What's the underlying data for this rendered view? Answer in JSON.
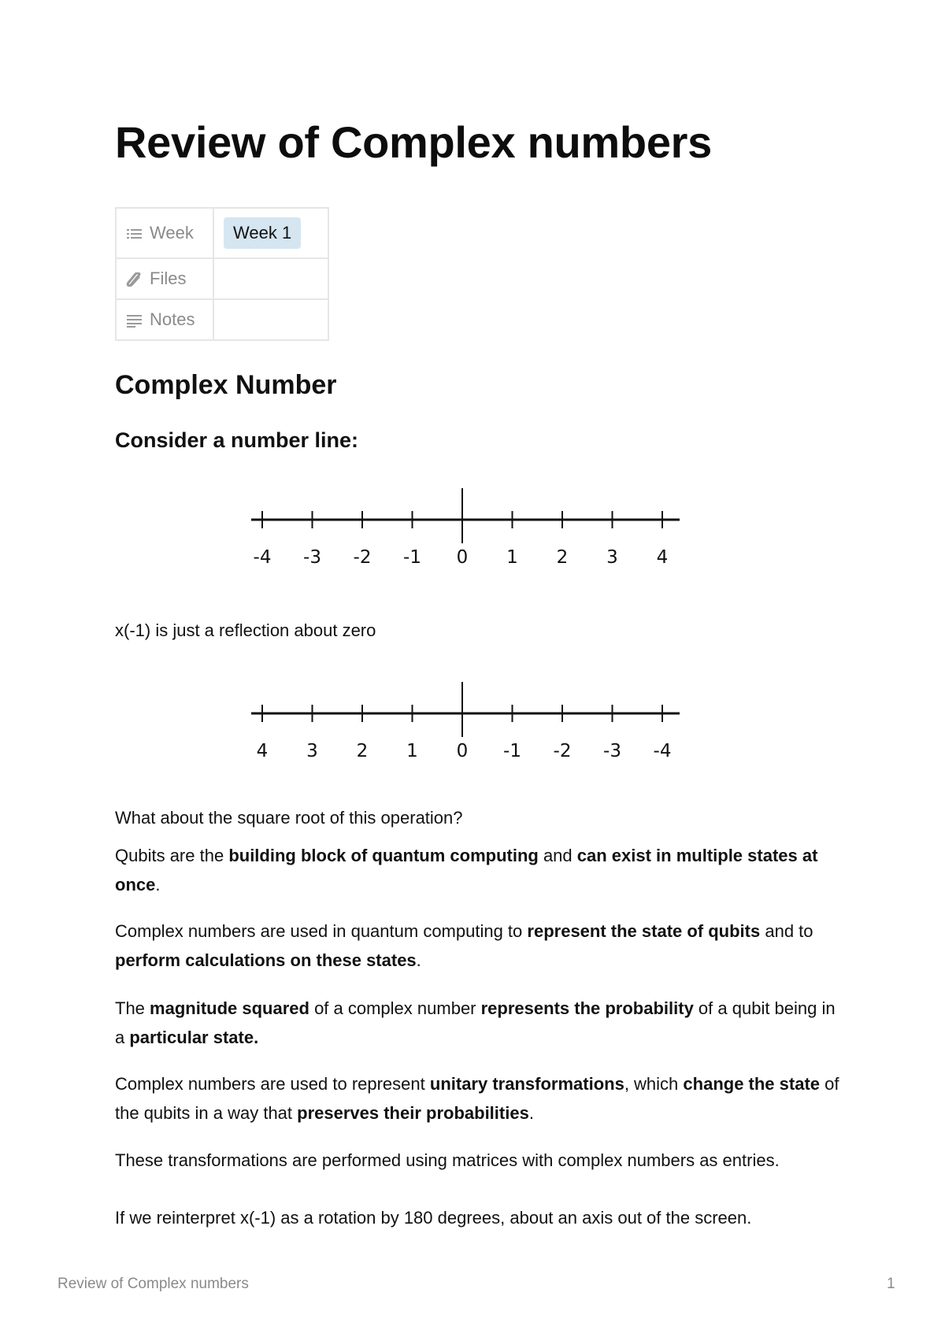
{
  "title": "Review of Complex numbers",
  "properties": [
    {
      "icon": "list-icon",
      "key": "Week",
      "value": "Week 1",
      "value_color": "#d5e6f1"
    },
    {
      "icon": "paperclip-icon",
      "key": "Files",
      "value": ""
    },
    {
      "icon": "text-lines-icon",
      "key": "Notes",
      "value": ""
    }
  ],
  "heading": "Complex Number",
  "subheading": "Consider a number line:",
  "number_line_1": {
    "labels": [
      "-4",
      "-3",
      "-2",
      "-1",
      "0",
      "1",
      "2",
      "3",
      "4"
    ]
  },
  "reflection_text": "x(-1) is just a reflection about zero",
  "number_line_2": {
    "labels": [
      "4",
      "3",
      "2",
      "1",
      "0",
      "-1",
      "-2",
      "-3",
      "-4"
    ]
  },
  "paragraphs": [
    [
      {
        "t": "What about the square root of this operation?",
        "b": false
      }
    ],
    [
      {
        "t": "Qubits are the ",
        "b": false
      },
      {
        "t": "building block of quantum computing",
        "b": true
      },
      {
        "t": " and ",
        "b": false
      },
      {
        "t": "can exist in multiple states at once",
        "b": true
      },
      {
        "t": ".",
        "b": false
      }
    ],
    [
      {
        "t": "Complex numbers are used in quantum computing to ",
        "b": false
      },
      {
        "t": "represent the state of qubits",
        "b": true
      },
      {
        "t": " and to ",
        "b": false
      },
      {
        "t": "perform calculations on these states",
        "b": true
      },
      {
        "t": ".",
        "b": false
      }
    ],
    [
      {
        "t": "The ",
        "b": false
      },
      {
        "t": "magnitude squared",
        "b": true
      },
      {
        "t": " of a complex number ",
        "b": false
      },
      {
        "t": "represents the probability",
        "b": true
      },
      {
        "t": " of a qubit being in a ",
        "b": false
      },
      {
        "t": "particular state.",
        "b": true
      }
    ],
    [
      {
        "t": "Complex numbers are used to represent ",
        "b": false
      },
      {
        "t": "unitary transformations",
        "b": true
      },
      {
        "t": ", which ",
        "b": false
      },
      {
        "t": "change the state",
        "b": true
      },
      {
        "t": " of the qubits in a way that ",
        "b": false
      },
      {
        "t": "preserves their probabilities",
        "b": true
      },
      {
        "t": ".",
        "b": false
      }
    ],
    [
      {
        "t": "These transformations are performed using matrices with complex numbers as entries.",
        "b": false
      }
    ],
    [
      {
        "t": "If we reinterpret x(-1) as a rotation by 180 degrees, about an axis out of the screen.",
        "b": false
      }
    ]
  ],
  "footer": {
    "title": "Review of Complex numbers",
    "page": "1"
  }
}
